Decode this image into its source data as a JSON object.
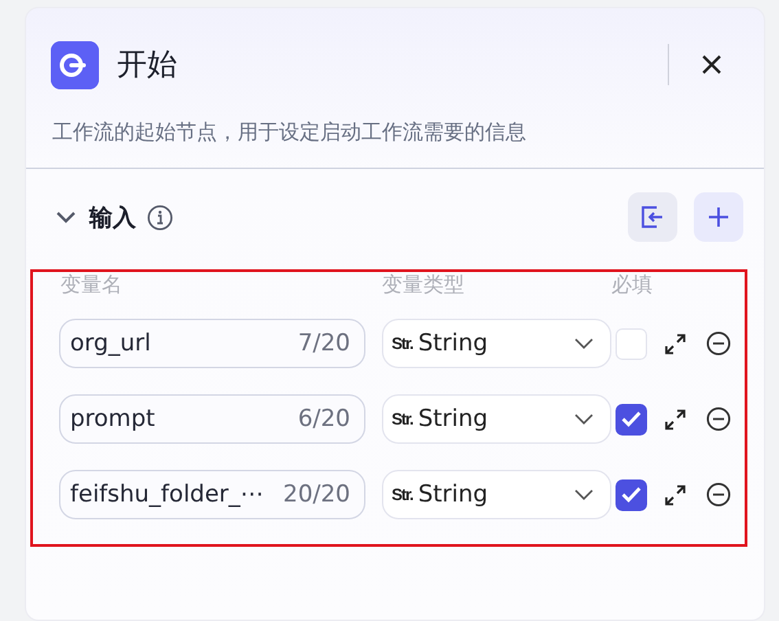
{
  "panel": {
    "title": "开始",
    "description": "工作流的起始节点，用于设定启动工作流需要的信息"
  },
  "section": {
    "title": "输入",
    "expanded": true
  },
  "table": {
    "columns": [
      "变量名",
      "变量类型",
      "必填"
    ],
    "rows": [
      {
        "name": "org_url",
        "count": "7/20",
        "type_icon": "Str.",
        "type": "String",
        "required": false
      },
      {
        "name": "prompt",
        "count": "6/20",
        "type_icon": "Str.",
        "type": "String",
        "required": true
      },
      {
        "name": "feifshu_folder_⋯",
        "count": "20/20",
        "type_icon": "Str.",
        "type": "String",
        "required": true
      }
    ]
  }
}
